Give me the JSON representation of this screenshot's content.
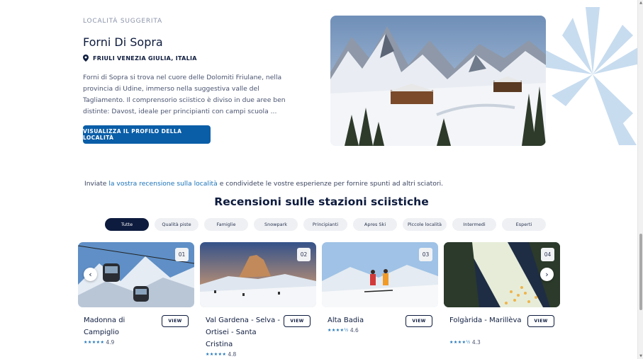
{
  "suggested": {
    "eyebrow": "LOCALITÀ SUGGERITA",
    "title": "Forni Di Sopra",
    "region": "FRIULI VENEZIA GIULIA, ITALIA",
    "description": "Forni di Sopra si trova nel cuore delle Dolomiti Friulane, nella provincia di Udine, immerso nella suggestiva valle del Tagliamento. Il comprensorio sciistico è diviso in due aree ben distinte: Davost, ideale per principianti con campi scuola ...",
    "cta_label": "VISUALIZZA IL PROFILO DELLA LOCALITÀ"
  },
  "invite": {
    "before": "Inviate ",
    "link": "la vostra recensione sulla località",
    "after": " e condividete le vostre esperienze per fornire spunti ad altri sciatori."
  },
  "reviews": {
    "title": "Recensioni sulle stazioni sciistiche",
    "filters": [
      "Tutte",
      "Qualità piste",
      "Famiglie",
      "Snowpark",
      "Principianti",
      "Apres Ski",
      "Piccole località",
      "Intermedi",
      "Esperti"
    ],
    "active_filter": "Tutte",
    "view_label": "VIEW",
    "cards": [
      {
        "num": "01",
        "name": "Madonna di Campiglio",
        "stars": "★★★★★",
        "rating": "4.9"
      },
      {
        "num": "02",
        "name": "Val Gardena - Selva - Ortisei - Santa Cristina",
        "stars": "★★★★★",
        "rating": "4.8"
      },
      {
        "num": "03",
        "name": "Alta Badia",
        "stars": "★★★★½",
        "rating": "4.6"
      },
      {
        "num": "04",
        "name": "Folgàrida - Marillèva",
        "stars": "★★★★½",
        "rating": "4.3"
      }
    ]
  },
  "colors": {
    "navy": "#0d1b3e",
    "accent": "#0a5ea8",
    "link": "#1a72b8",
    "flake": "#c7dcef"
  },
  "icons": {
    "pin": "map-pin-icon",
    "prev": "chevron-left-icon",
    "next": "chevron-right-icon",
    "decor": "snowflake-icon"
  }
}
